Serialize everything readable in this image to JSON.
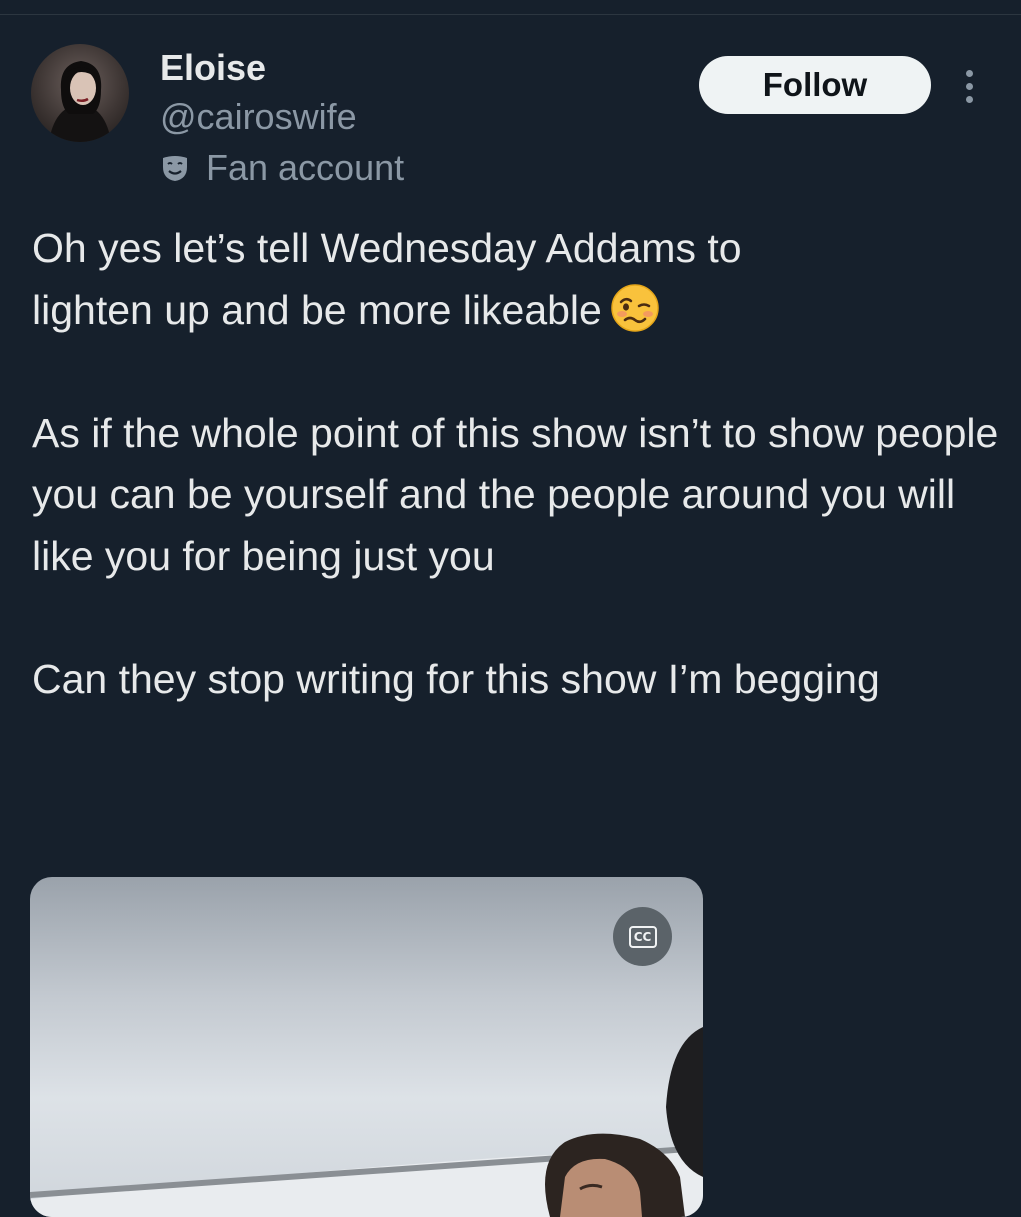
{
  "tweet": {
    "author": {
      "display_name": "Eloise",
      "handle": "@cairoswife",
      "label": "Fan account",
      "label_icon": "theater-mask-icon",
      "avatar_icon": "avatar"
    },
    "follow_label": "Follow",
    "more_icon": "more-options-icon",
    "text": {
      "paragraph1_line1": "Oh yes let’s tell Wednesday Addams to",
      "paragraph1_line2": "lighten up and be more likeable",
      "paragraph1_emoji": "woozy-face-emoji",
      "paragraph2": "As if the whole point of this show isn’t to show people you can be yourself and the people around you will like you for being just you",
      "paragraph3": "Can they stop writing for this show I’m begging"
    },
    "media": {
      "type": "video",
      "captions_label": "CC"
    }
  },
  "colors": {
    "background": "#16202c",
    "text_primary": "#e7e9ea",
    "text_secondary": "#8b98a5",
    "follow_bg": "#eff3f4",
    "follow_text": "#0f1419"
  }
}
